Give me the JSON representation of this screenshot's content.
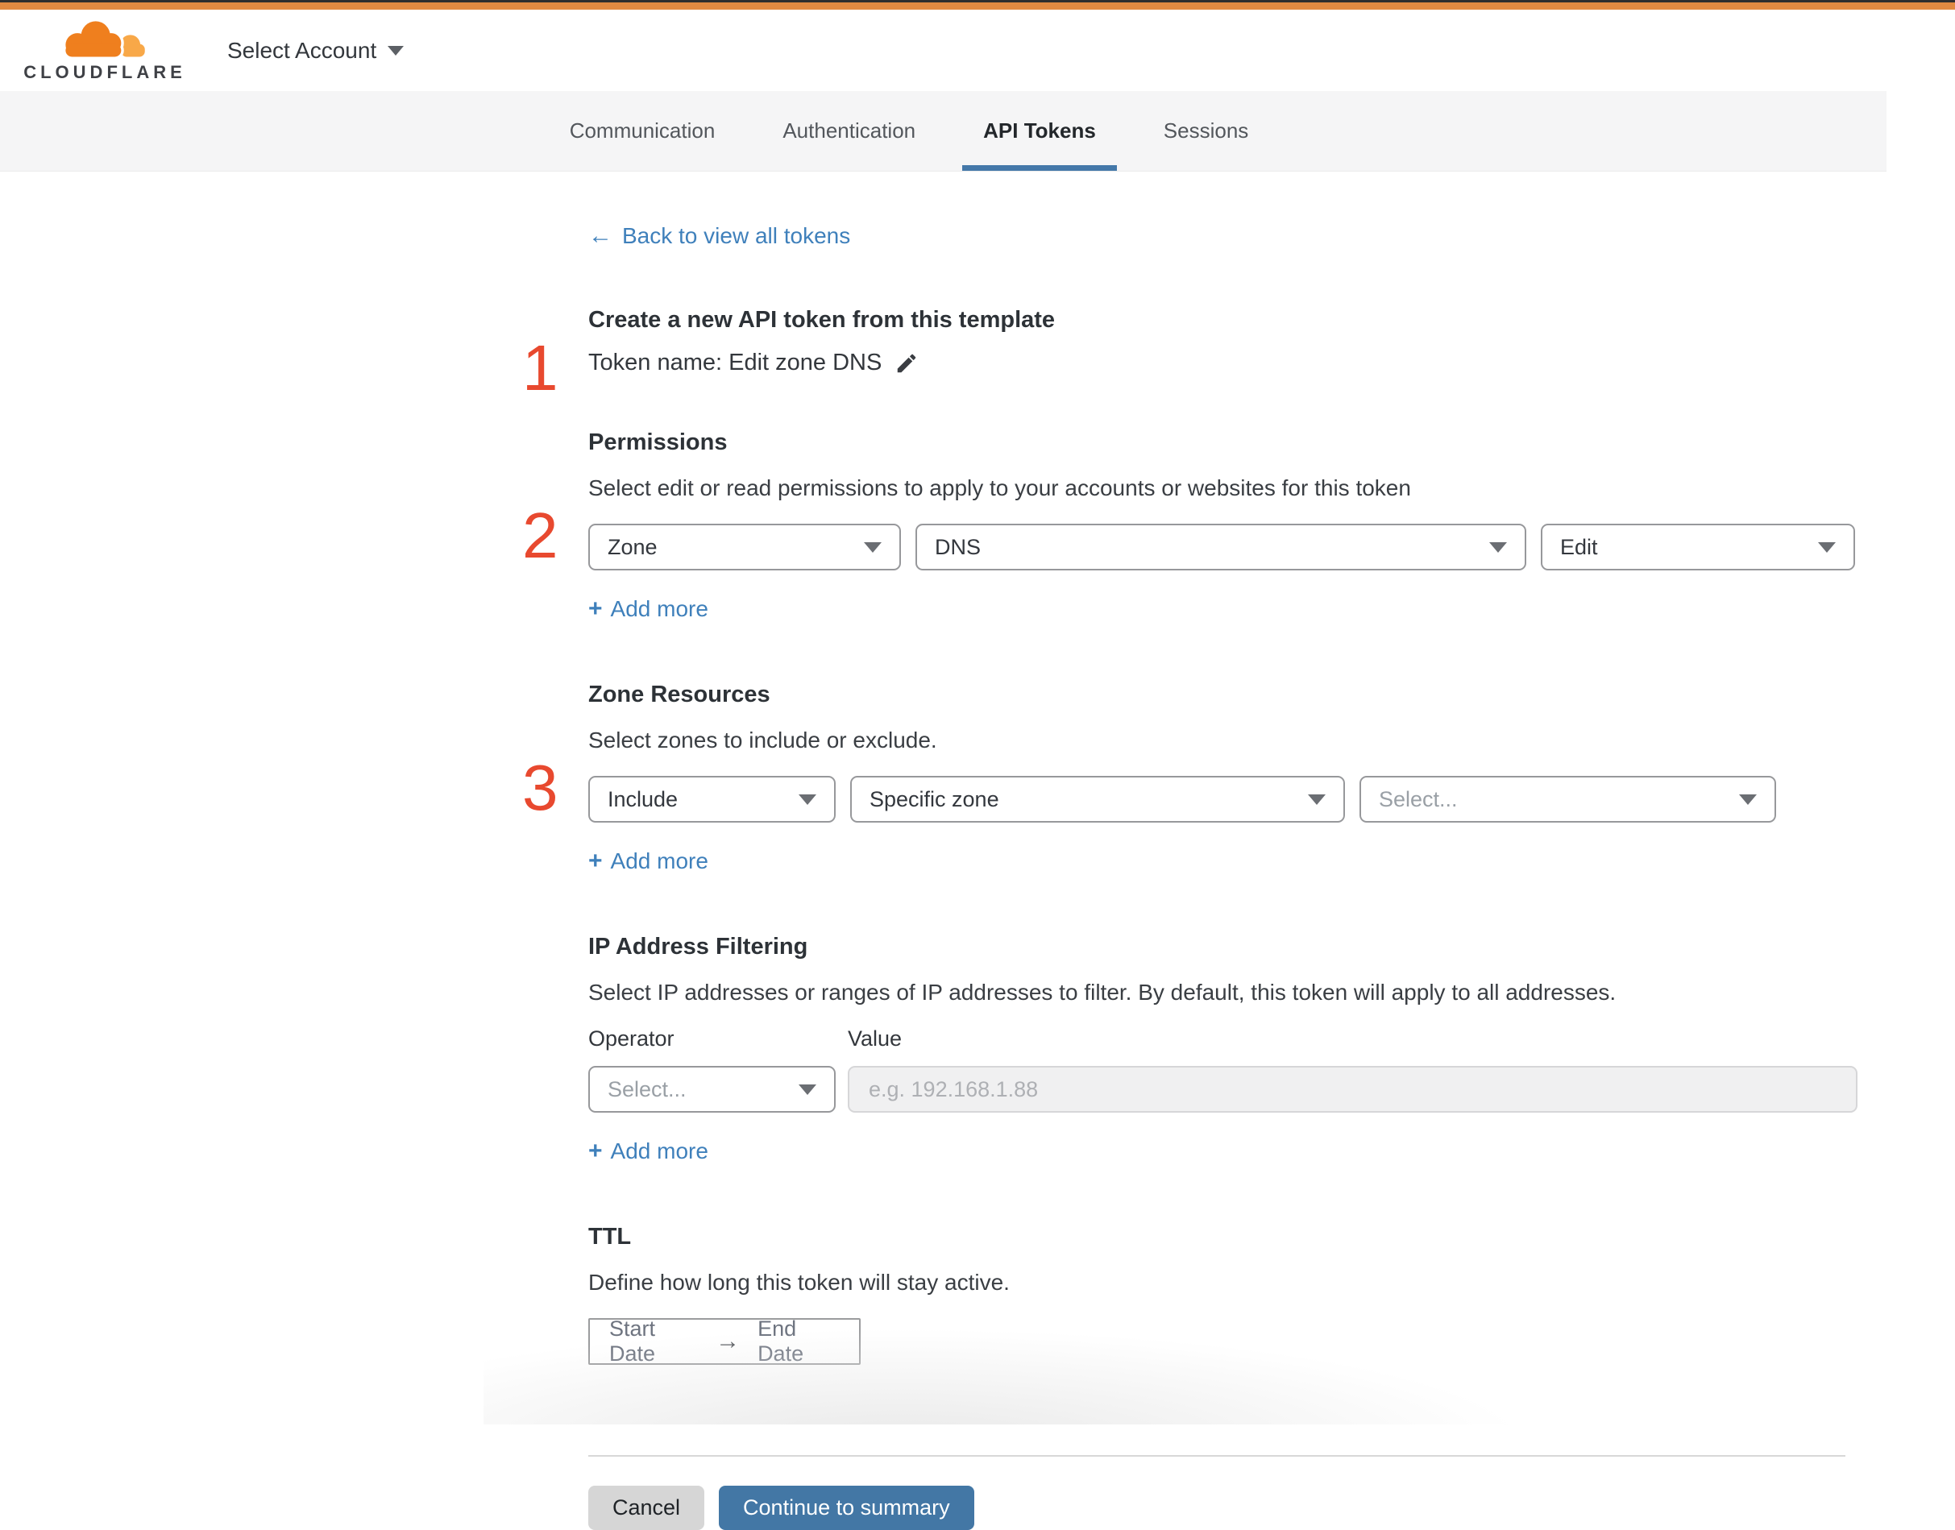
{
  "colors": {
    "top_accent_orange": "#e18a41",
    "brand_orange": "#ef7f1e",
    "brand_orange_light": "#f8a848",
    "link_blue": "#3f80bb",
    "primary_button_blue": "#4377a5",
    "active_tab_underline": "#4478a9",
    "step_number_red": "#e8492f"
  },
  "header": {
    "brand": "CLOUDFLARE",
    "account_label": "Select Account"
  },
  "tabs": {
    "items": [
      {
        "label": "Communication",
        "active": false
      },
      {
        "label": "Authentication",
        "active": false
      },
      {
        "label": "API Tokens",
        "active": true
      },
      {
        "label": "Sessions",
        "active": false
      }
    ]
  },
  "page": {
    "back_label": "Back to view all tokens",
    "title": "Create a new API token from this template",
    "token_name": "Token name: Edit zone DNS",
    "steps": {
      "one": "1",
      "two": "2",
      "three": "3"
    },
    "add_more_label": "Add more",
    "plus_glyph": "+",
    "back_arrow_glyph": "←",
    "range_arrow_glyph": "→"
  },
  "permissions": {
    "title": "Permissions",
    "description": "Select edit or read permissions to apply to your accounts or websites for this token",
    "scope": {
      "value": "Zone"
    },
    "resource": {
      "value": "DNS"
    },
    "access": {
      "value": "Edit"
    }
  },
  "zone_resources": {
    "title": "Zone Resources",
    "description": "Select zones to include or exclude.",
    "mode": {
      "value": "Include"
    },
    "zone_type": {
      "value": "Specific zone"
    },
    "zone_pick": {
      "value": "Select..."
    }
  },
  "ip_filtering": {
    "title": "IP Address Filtering",
    "description": "Select IP addresses or ranges of IP addresses to filter. By default, this token will apply to all addresses.",
    "operator_label": "Operator",
    "value_label": "Value",
    "operator": {
      "value": "Select..."
    },
    "value_input": {
      "value": "",
      "placeholder": "e.g. 192.168.1.88"
    }
  },
  "ttl": {
    "title": "TTL",
    "description": "Define how long this token will stay active.",
    "start_label": "Start Date",
    "end_label": "End Date"
  },
  "footer": {
    "cancel_label": "Cancel",
    "continue_label": "Continue to summary"
  }
}
